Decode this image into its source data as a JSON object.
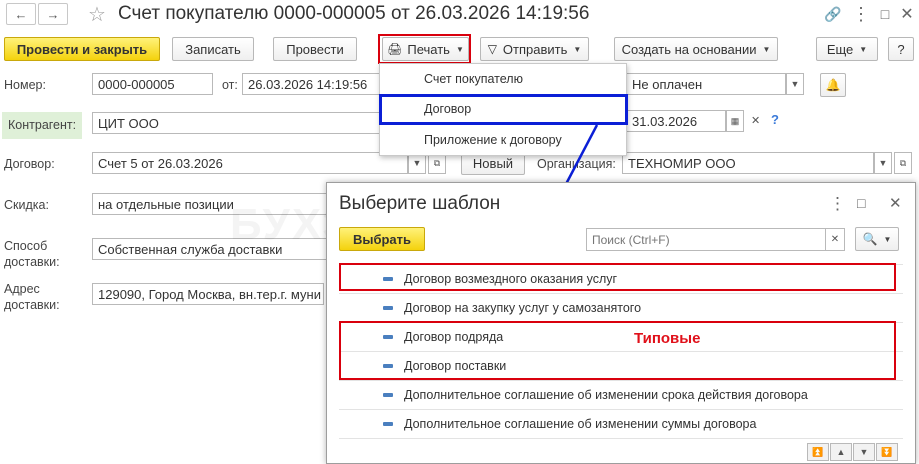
{
  "window": {
    "title": "Счет покупателю 0000-000005 от 26.03.2026 14:19:56"
  },
  "toolbar": {
    "post_close": "Провести и закрыть",
    "save": "Записать",
    "post": "Провести",
    "print": "Печать",
    "send": "Отправить",
    "create_based": "Создать на основании",
    "more": "Еще",
    "help": "?"
  },
  "print_menu": {
    "items": [
      "Счет покупателю",
      "Договор",
      "Приложение к договору"
    ]
  },
  "form": {
    "number_label": "Номер:",
    "number_value": "0000-000005",
    "from_label": "от:",
    "from_value": "26.03.2026 14:19:56",
    "status_value": "Не оплачен",
    "contractor_label": "Контрагент:",
    "contractor_value": "ЦИТ ООО",
    "date2_value": "31.03.2026",
    "help_q": "?",
    "contract_label": "Договор:",
    "contract_value": "Счет 5 от 26.03.2026",
    "new_button": "Новый",
    "org_label": "Организация:",
    "org_value": "ТЕХНОМИР ООО",
    "discount_label": "Скидка:",
    "discount_value": "на отдельные позиции",
    "delivery_label": "Способ доставки:",
    "delivery_value": "Собственная служба доставки",
    "address_label": "Адрес доставки:",
    "address_value": "129090, Город Москва, вн.тер.г. муни"
  },
  "dialog": {
    "title": "Выберите шаблон",
    "select_button": "Выбрать",
    "search_placeholder": "Поиск (Ctrl+F)",
    "typical_label": "Типовые",
    "templates": [
      "Договор возмездного оказания услуг",
      "Договор на закупку услуг у самозанятого",
      "Договор подряда",
      "Договор поставки",
      "Дополнительное соглашение об изменении срока действия договора",
      "Дополнительное соглашение об изменении суммы договора"
    ]
  },
  "watermark": "БУХЭКСПЕРТ"
}
